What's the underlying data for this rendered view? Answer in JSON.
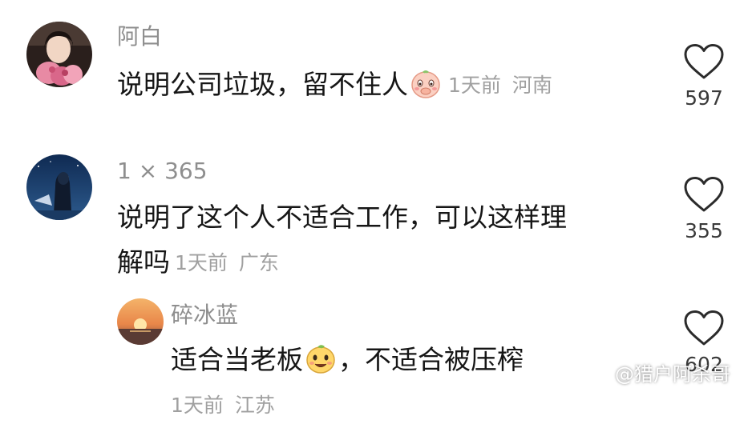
{
  "comments": [
    {
      "username": "阿白",
      "text": "说明公司垃圾，留不住人",
      "emoji": "blushing-peach-emoji",
      "time": "1天前",
      "location": "河南",
      "likes": "597",
      "avatar": "girl-with-flowers-avatar"
    },
    {
      "username": "1 × 365",
      "text_line1": "说明了这个人不适合工作，可以这样理",
      "text_line2": "解吗",
      "time": "1天前",
      "location": "广东",
      "likes": "355",
      "avatar": "night-sky-avatar"
    },
    {
      "username": "碎冰蓝",
      "text_before_emoji": "适合当老板",
      "emoji": "yellow-smiley-emoji",
      "text_after_emoji": "，不适合被压榨",
      "time": "1天前",
      "location": "江苏",
      "likes": "602",
      "avatar": "sunset-avatar"
    }
  ],
  "watermark": "@猎户阿杀哥",
  "icons": {
    "like": "heart-icon",
    "watermark_logo": "weibo-icon"
  },
  "colors": {
    "username": "#8e8e8e",
    "meta": "#a0a0a0",
    "text": "#161616",
    "heart": "#2b2b2b"
  }
}
